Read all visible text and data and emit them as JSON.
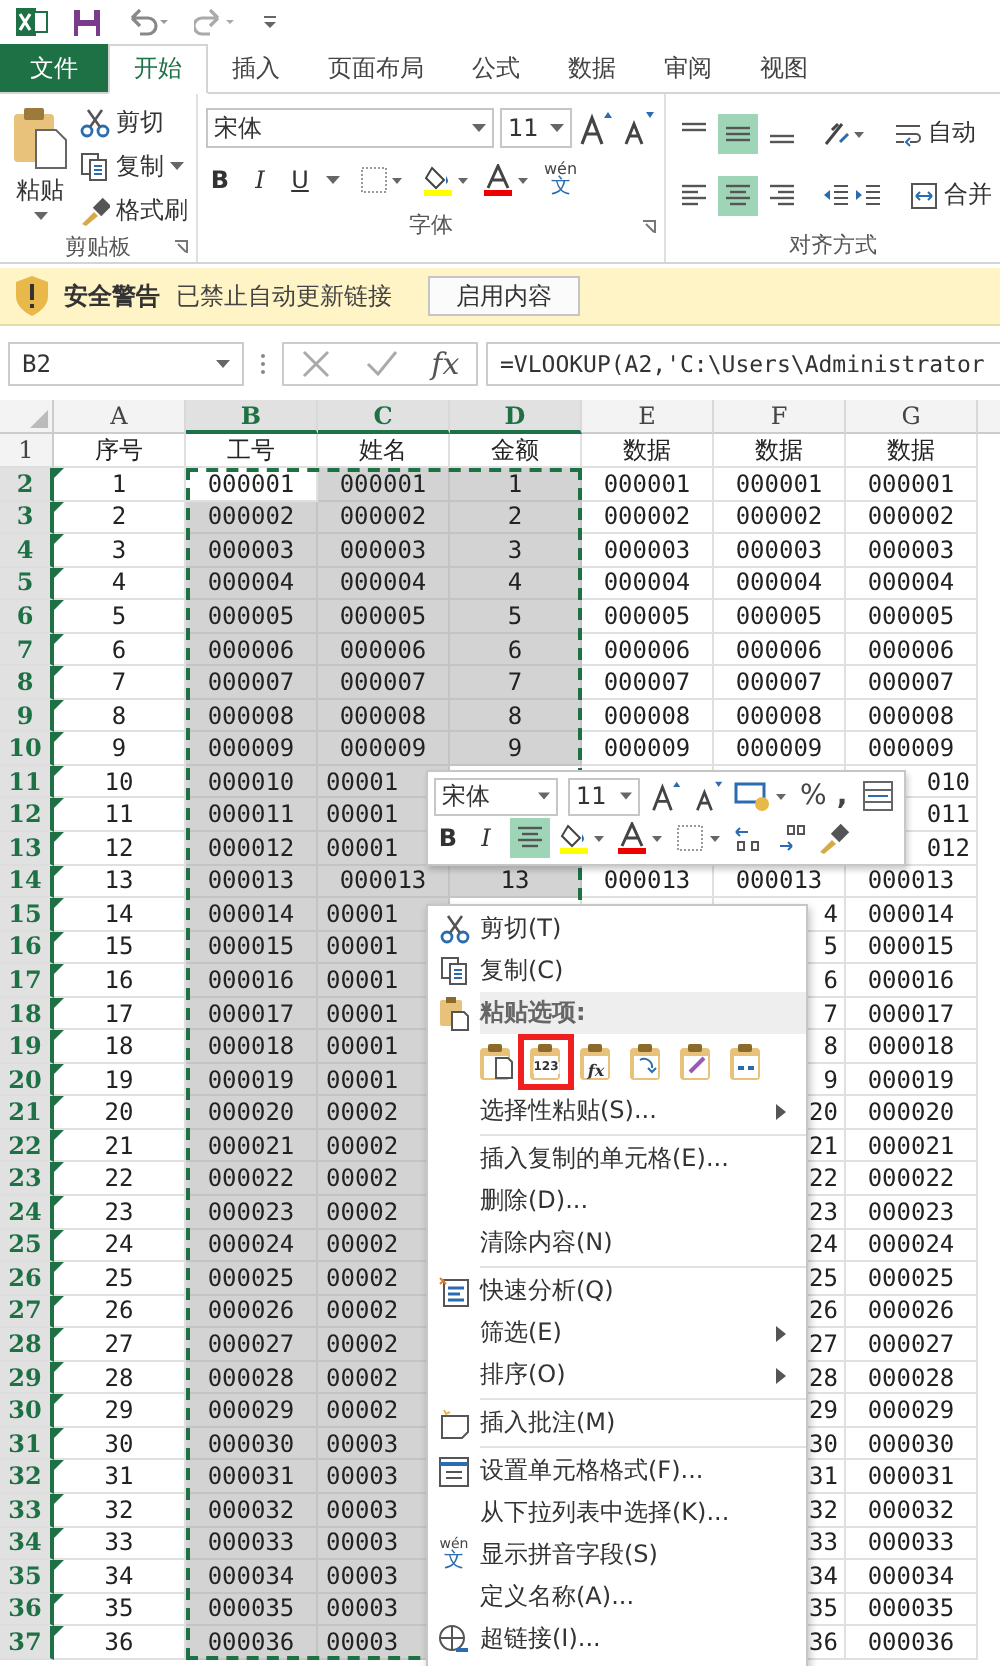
{
  "tabs": [
    {
      "label": "文件",
      "kind": "file",
      "selected": false
    },
    {
      "label": "开始",
      "kind": "tab",
      "selected": true
    },
    {
      "label": "插入",
      "kind": "tab",
      "selected": false
    },
    {
      "label": "页面布局",
      "kind": "tab",
      "selected": false
    },
    {
      "label": "公式",
      "kind": "tab",
      "selected": false
    },
    {
      "label": "数据",
      "kind": "tab",
      "selected": false
    },
    {
      "label": "审阅",
      "kind": "tab",
      "selected": false
    },
    {
      "label": "视图",
      "kind": "tab",
      "selected": false
    }
  ],
  "ribbon": {
    "clipboard": {
      "label": "剪贴板",
      "paste": "粘贴",
      "cut": "剪切",
      "copy": "复制",
      "format_painter": "格式刷"
    },
    "font": {
      "label": "字体",
      "font_name": "宋体",
      "font_size": "11",
      "bold": "B",
      "italic": "I",
      "underline": "U",
      "phonetic_top": "wén",
      "phonetic_bottom": "文"
    },
    "alignment": {
      "label": "对齐方式",
      "wrap_text": "自动",
      "merge": "合并",
      "vertical": [
        {
          "kind": "top",
          "selected": false
        },
        {
          "kind": "middle",
          "selected": true
        },
        {
          "kind": "bottom",
          "selected": false
        }
      ],
      "horizontal": [
        {
          "kind": "left",
          "selected": false
        },
        {
          "kind": "center",
          "selected": true
        },
        {
          "kind": "right",
          "selected": false
        }
      ]
    }
  },
  "security_bar": {
    "title": "安全警告",
    "message": "已禁止自动更新链接",
    "button": "启用内容"
  },
  "formula_bar": {
    "name_box": "B2",
    "insert_function": "fx",
    "formula": "=VLOOKUP(A2,'C:\\Users\\Administrator"
  },
  "sheet": {
    "columns": [
      {
        "label": "A",
        "selected": false
      },
      {
        "label": "B",
        "selected": true
      },
      {
        "label": "C",
        "selected": true
      },
      {
        "label": "D",
        "selected": true
      },
      {
        "label": "E",
        "selected": false
      },
      {
        "label": "F",
        "selected": false
      },
      {
        "label": "G",
        "selected": false
      }
    ],
    "rows": [
      {
        "n": "1",
        "selected": false,
        "error_flag": false,
        "cells": [
          "序号",
          "工号",
          "姓名",
          "金额",
          "数据",
          "数据",
          "数据"
        ]
      },
      {
        "n": "2",
        "selected": true,
        "error_flag": true,
        "cells": [
          "1",
          {
            "text": "000001",
            "kind": "active"
          },
          "000001",
          "1",
          "000001",
          "000001",
          "000001"
        ]
      },
      {
        "n": "3",
        "selected": true,
        "error_flag": true,
        "cells": [
          "2",
          "000002",
          "000002",
          "2",
          "000002",
          "000002",
          "000002"
        ]
      },
      {
        "n": "4",
        "selected": true,
        "error_flag": true,
        "cells": [
          "3",
          "000003",
          "000003",
          "3",
          "000003",
          "000003",
          "000003"
        ]
      },
      {
        "n": "5",
        "selected": true,
        "error_flag": true,
        "cells": [
          "4",
          "000004",
          "000004",
          "4",
          "000004",
          "000004",
          "000004"
        ]
      },
      {
        "n": "6",
        "selected": true,
        "error_flag": true,
        "cells": [
          "5",
          "000005",
          "000005",
          "5",
          "000005",
          "000005",
          "000005"
        ]
      },
      {
        "n": "7",
        "selected": true,
        "error_flag": true,
        "cells": [
          "6",
          "000006",
          "000006",
          "6",
          "000006",
          "000006",
          "000006"
        ]
      },
      {
        "n": "8",
        "selected": true,
        "error_flag": true,
        "cells": [
          "7",
          "000007",
          "000007",
          "7",
          "000007",
          "000007",
          "000007"
        ]
      },
      {
        "n": "9",
        "selected": true,
        "error_flag": true,
        "cells": [
          "8",
          "000008",
          "000008",
          "8",
          "000008",
          "000008",
          "000008"
        ]
      },
      {
        "n": "10",
        "selected": true,
        "error_flag": true,
        "cells": [
          "9",
          "000009",
          "000009",
          "9",
          "000009",
          "000009",
          "000009"
        ]
      },
      {
        "n": "11",
        "selected": true,
        "error_flag": true,
        "cells": [
          "10",
          "000010",
          {
            "text": "00001",
            "kind": "cut_right"
          },
          null,
          null,
          null,
          {
            "text": "010",
            "kind": "cut_left"
          }
        ]
      },
      {
        "n": "12",
        "selected": true,
        "error_flag": true,
        "cells": [
          "11",
          "000011",
          {
            "text": "00001",
            "kind": "cut_right"
          },
          null,
          null,
          null,
          {
            "text": "011",
            "kind": "cut_left"
          }
        ]
      },
      {
        "n": "13",
        "selected": true,
        "error_flag": true,
        "cells": [
          "12",
          "000012",
          {
            "text": "00001",
            "kind": "cut_right"
          },
          null,
          null,
          null,
          {
            "text": "012",
            "kind": "cut_left"
          }
        ]
      },
      {
        "n": "14",
        "selected": true,
        "error_flag": true,
        "cells": [
          "13",
          "000013",
          "000013",
          "13",
          "000013",
          "000013",
          "000013"
        ]
      },
      {
        "n": "15",
        "selected": true,
        "error_flag": true,
        "cells": [
          "14",
          "000014",
          {
            "text": "00001",
            "kind": "cut_right"
          },
          null,
          null,
          {
            "text": "4",
            "kind": "cut_left"
          },
          "000014"
        ]
      },
      {
        "n": "16",
        "selected": true,
        "error_flag": true,
        "cells": [
          "15",
          "000015",
          {
            "text": "00001",
            "kind": "cut_right"
          },
          null,
          null,
          {
            "text": "5",
            "kind": "cut_left"
          },
          "000015"
        ]
      },
      {
        "n": "17",
        "selected": true,
        "error_flag": true,
        "cells": [
          "16",
          "000016",
          {
            "text": "00001",
            "kind": "cut_right"
          },
          null,
          null,
          {
            "text": "6",
            "kind": "cut_left"
          },
          "000016"
        ]
      },
      {
        "n": "18",
        "selected": true,
        "error_flag": true,
        "cells": [
          "17",
          "000017",
          {
            "text": "00001",
            "kind": "cut_right"
          },
          null,
          null,
          {
            "text": "7",
            "kind": "cut_left"
          },
          "000017"
        ]
      },
      {
        "n": "19",
        "selected": true,
        "error_flag": true,
        "cells": [
          "18",
          "000018",
          {
            "text": "00001",
            "kind": "cut_right"
          },
          null,
          null,
          {
            "text": "8",
            "kind": "cut_left"
          },
          "000018"
        ]
      },
      {
        "n": "20",
        "selected": true,
        "error_flag": true,
        "cells": [
          "19",
          "000019",
          {
            "text": "00001",
            "kind": "cut_right"
          },
          null,
          null,
          {
            "text": "9",
            "kind": "cut_left"
          },
          "000019"
        ]
      },
      {
        "n": "21",
        "selected": true,
        "error_flag": true,
        "cells": [
          "20",
          "000020",
          {
            "text": "00002",
            "kind": "cut_right"
          },
          null,
          null,
          {
            "text": "20",
            "kind": "cut_left"
          },
          "000020"
        ]
      },
      {
        "n": "22",
        "selected": true,
        "error_flag": true,
        "cells": [
          "21",
          "000021",
          {
            "text": "00002",
            "kind": "cut_right"
          },
          null,
          null,
          {
            "text": "21",
            "kind": "cut_left"
          },
          "000021"
        ]
      },
      {
        "n": "23",
        "selected": true,
        "error_flag": true,
        "cells": [
          "22",
          "000022",
          {
            "text": "00002",
            "kind": "cut_right"
          },
          null,
          null,
          {
            "text": "22",
            "kind": "cut_left"
          },
          "000022"
        ]
      },
      {
        "n": "24",
        "selected": true,
        "error_flag": true,
        "cells": [
          "23",
          "000023",
          {
            "text": "00002",
            "kind": "cut_right"
          },
          null,
          null,
          {
            "text": "23",
            "kind": "cut_left"
          },
          "000023"
        ]
      },
      {
        "n": "25",
        "selected": true,
        "error_flag": true,
        "cells": [
          "24",
          "000024",
          {
            "text": "00002",
            "kind": "cut_right"
          },
          null,
          null,
          {
            "text": "24",
            "kind": "cut_left"
          },
          "000024"
        ]
      },
      {
        "n": "26",
        "selected": true,
        "error_flag": true,
        "cells": [
          "25",
          "000025",
          {
            "text": "00002",
            "kind": "cut_right"
          },
          null,
          null,
          {
            "text": "25",
            "kind": "cut_left"
          },
          "000025"
        ]
      },
      {
        "n": "27",
        "selected": true,
        "error_flag": true,
        "cells": [
          "26",
          "000026",
          {
            "text": "00002",
            "kind": "cut_right"
          },
          null,
          null,
          {
            "text": "26",
            "kind": "cut_left"
          },
          "000026"
        ]
      },
      {
        "n": "28",
        "selected": true,
        "error_flag": true,
        "cells": [
          "27",
          "000027",
          {
            "text": "00002",
            "kind": "cut_right"
          },
          null,
          null,
          {
            "text": "27",
            "kind": "cut_left"
          },
          "000027"
        ]
      },
      {
        "n": "29",
        "selected": true,
        "error_flag": true,
        "cells": [
          "28",
          "000028",
          {
            "text": "00002",
            "kind": "cut_right"
          },
          null,
          null,
          {
            "text": "28",
            "kind": "cut_left"
          },
          "000028"
        ]
      },
      {
        "n": "30",
        "selected": true,
        "error_flag": true,
        "cells": [
          "29",
          "000029",
          {
            "text": "00002",
            "kind": "cut_right"
          },
          null,
          null,
          {
            "text": "29",
            "kind": "cut_left"
          },
          "000029"
        ]
      },
      {
        "n": "31",
        "selected": true,
        "error_flag": true,
        "cells": [
          "30",
          "000030",
          {
            "text": "00003",
            "kind": "cut_right"
          },
          null,
          null,
          {
            "text": "30",
            "kind": "cut_left"
          },
          "000030"
        ]
      },
      {
        "n": "32",
        "selected": true,
        "error_flag": true,
        "cells": [
          "31",
          "000031",
          {
            "text": "00003",
            "kind": "cut_right"
          },
          null,
          null,
          {
            "text": "31",
            "kind": "cut_left"
          },
          "000031"
        ]
      },
      {
        "n": "33",
        "selected": true,
        "error_flag": true,
        "cells": [
          "32",
          "000032",
          {
            "text": "00003",
            "kind": "cut_right"
          },
          null,
          null,
          {
            "text": "32",
            "kind": "cut_left"
          },
          "000032"
        ]
      },
      {
        "n": "34",
        "selected": true,
        "error_flag": true,
        "cells": [
          "33",
          "000033",
          {
            "text": "00003",
            "kind": "cut_right"
          },
          null,
          null,
          {
            "text": "33",
            "kind": "cut_left"
          },
          "000033"
        ]
      },
      {
        "n": "35",
        "selected": true,
        "error_flag": true,
        "cells": [
          "34",
          "000034",
          {
            "text": "00003",
            "kind": "cut_right"
          },
          null,
          null,
          {
            "text": "34",
            "kind": "cut_left"
          },
          "000034"
        ]
      },
      {
        "n": "36",
        "selected": true,
        "error_flag": true,
        "cells": [
          "35",
          "000035",
          {
            "text": "00003",
            "kind": "cut_right"
          },
          null,
          null,
          {
            "text": "35",
            "kind": "cut_left"
          },
          "000035"
        ]
      },
      {
        "n": "37",
        "selected": true,
        "error_flag": true,
        "cells": [
          "36",
          "000036",
          {
            "text": "00003",
            "kind": "cut_right"
          },
          null,
          null,
          {
            "text": "36",
            "kind": "cut_left"
          },
          "000036"
        ]
      }
    ]
  },
  "mini_toolbar": {
    "font_name": "宋体",
    "font_size": "11",
    "percent": "%",
    "comma": ",",
    "bold": "B",
    "italic": "I",
    "center_selected": true
  },
  "context_menu": [
    {
      "kind": "item",
      "label": "剪切(T)",
      "submenu": false
    },
    {
      "kind": "item",
      "label": "复制(C)",
      "submenu": false
    },
    {
      "kind": "header",
      "label": "粘贴选项:"
    },
    {
      "kind": "paste_row",
      "options": [
        {
          "kind": "paste",
          "selected": false
        },
        {
          "kind": "values",
          "label": "123",
          "selected": true
        },
        {
          "kind": "formula",
          "label": "fx",
          "selected": false
        },
        {
          "kind": "transpose",
          "selected": false
        },
        {
          "kind": "formatting",
          "selected": false
        },
        {
          "kind": "link",
          "selected": false
        }
      ]
    },
    {
      "kind": "item",
      "label": "选择性粘贴(S)...",
      "submenu": true
    },
    {
      "kind": "separator"
    },
    {
      "kind": "item",
      "label": "插入复制的单元格(E)...",
      "submenu": false
    },
    {
      "kind": "item",
      "label": "删除(D)...",
      "submenu": false
    },
    {
      "kind": "item",
      "label": "清除内容(N)",
      "submenu": false
    },
    {
      "kind": "separator"
    },
    {
      "kind": "item",
      "label": "快速分析(Q)",
      "submenu": false
    },
    {
      "kind": "item",
      "label": "筛选(E)",
      "submenu": true
    },
    {
      "kind": "item",
      "label": "排序(O)",
      "submenu": true
    },
    {
      "kind": "separator"
    },
    {
      "kind": "item",
      "label": "插入批注(M)",
      "submenu": false
    },
    {
      "kind": "separator"
    },
    {
      "kind": "item",
      "label": "设置单元格格式(F)...",
      "submenu": false
    },
    {
      "kind": "item",
      "label": "从下拉列表中选择(K)...",
      "submenu": false
    },
    {
      "kind": "item",
      "label": "显示拼音字段(S)",
      "icon_top": "wén",
      "icon_bottom": "文",
      "submenu": false
    },
    {
      "kind": "item",
      "label": "定义名称(A)...",
      "submenu": false
    },
    {
      "kind": "item",
      "label": "超链接(I)...",
      "submenu": false
    }
  ]
}
